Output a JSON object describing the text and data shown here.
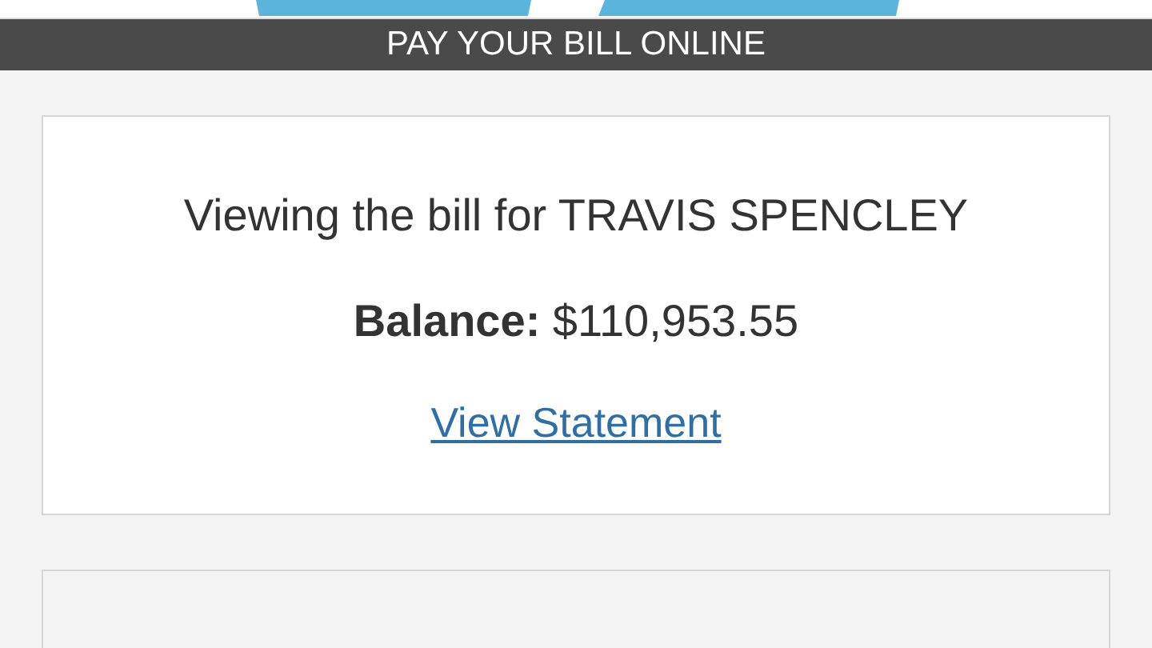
{
  "banner": {
    "title": "PAY YOUR BILL ONLINE"
  },
  "bill_card": {
    "heading": "Viewing the bill for TRAVIS SPENCLEY",
    "balance": "**Balance:** $110,953.55",
    "link": "View Statement"
  }
}
